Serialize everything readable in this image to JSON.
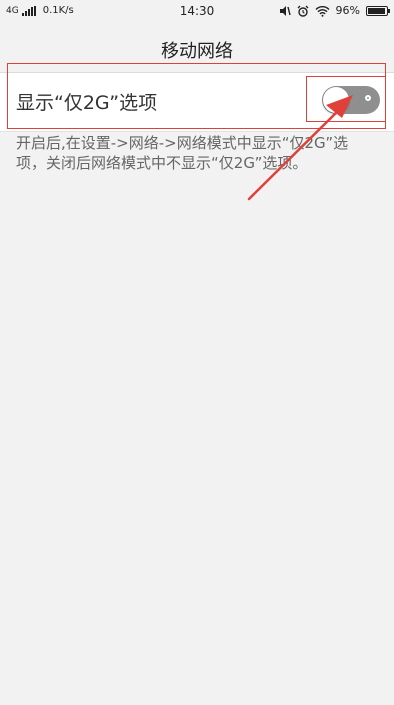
{
  "status_bar": {
    "network": "4G",
    "speed": "0.1K/s",
    "time": "14:30",
    "battery": "96%",
    "battery_level": 0.96
  },
  "header": {
    "title": "移动网络"
  },
  "setting": {
    "label": "显示“仅2G”选项",
    "enabled": false,
    "description": "开启后,在设置->网络->网络模式中显示“仅2G”选项，关闭后网络模式中不显示“仅2G”选项。"
  },
  "colors": {
    "annotation": "#e0403a",
    "toggle_off": "#8f8f8f"
  }
}
